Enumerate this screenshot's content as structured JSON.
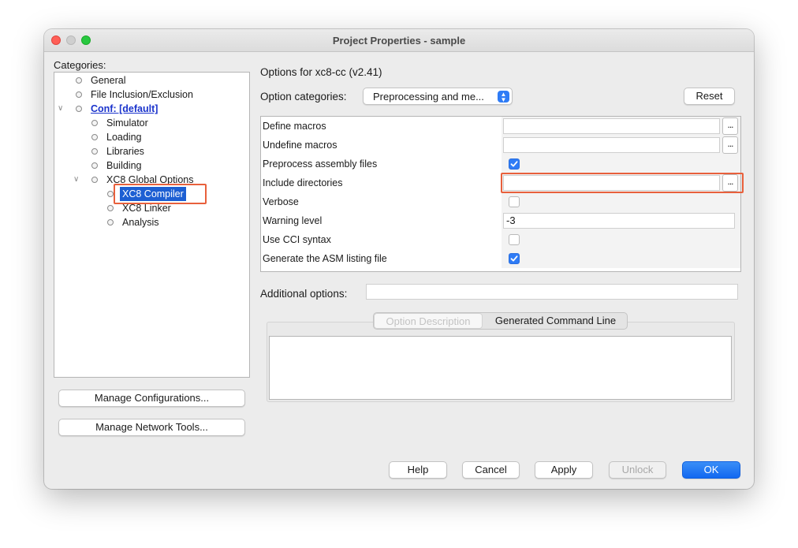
{
  "window": {
    "title": "Project Properties - sample"
  },
  "categories": {
    "label": "Categories:",
    "items": [
      {
        "label": "General"
      },
      {
        "label": "File Inclusion/Exclusion"
      },
      {
        "label": "Conf: [default]"
      },
      {
        "label": "Simulator"
      },
      {
        "label": "Loading"
      },
      {
        "label": "Libraries"
      },
      {
        "label": "Building"
      },
      {
        "label": "XC8 Global Options"
      },
      {
        "label": "XC8 Compiler"
      },
      {
        "label": "XC8 Linker"
      },
      {
        "label": "Analysis"
      }
    ],
    "selected": "XC8 Compiler"
  },
  "left_buttons": {
    "manage_configurations": "Manage Configurations...",
    "manage_network_tools": "Manage Network Tools..."
  },
  "options": {
    "title": "Options for xc8-cc (v2.41)",
    "category_label": "Option categories:",
    "category_value": "Preprocessing and me...",
    "reset": "Reset",
    "rows": [
      {
        "name": "Define macros",
        "value": "",
        "type": "text-browse"
      },
      {
        "name": "Undefine macros",
        "value": "",
        "type": "text-browse"
      },
      {
        "name": "Preprocess assembly files",
        "checked": true,
        "type": "checkbox"
      },
      {
        "name": "Include directories",
        "value": "",
        "type": "text-browse"
      },
      {
        "name": "Verbose",
        "checked": false,
        "type": "checkbox"
      },
      {
        "name": "Warning level",
        "value": "-3",
        "type": "text"
      },
      {
        "name": "Use CCI syntax",
        "checked": false,
        "type": "checkbox"
      },
      {
        "name": "Generate the ASM listing file",
        "checked": true,
        "type": "checkbox"
      }
    ],
    "browse_label": "...",
    "additional_label": "Additional options:",
    "additional_value": ""
  },
  "tabs": {
    "option_description": "Option Description",
    "generated_command_line": "Generated Command Line"
  },
  "footer": {
    "help": "Help",
    "cancel": "Cancel",
    "apply": "Apply",
    "unlock": "Unlock",
    "ok": "OK"
  },
  "colors": {
    "accent": "#1268f0",
    "selection": "#1d5fd3",
    "highlight_box": "#e8603c",
    "link": "#1a33cc"
  }
}
